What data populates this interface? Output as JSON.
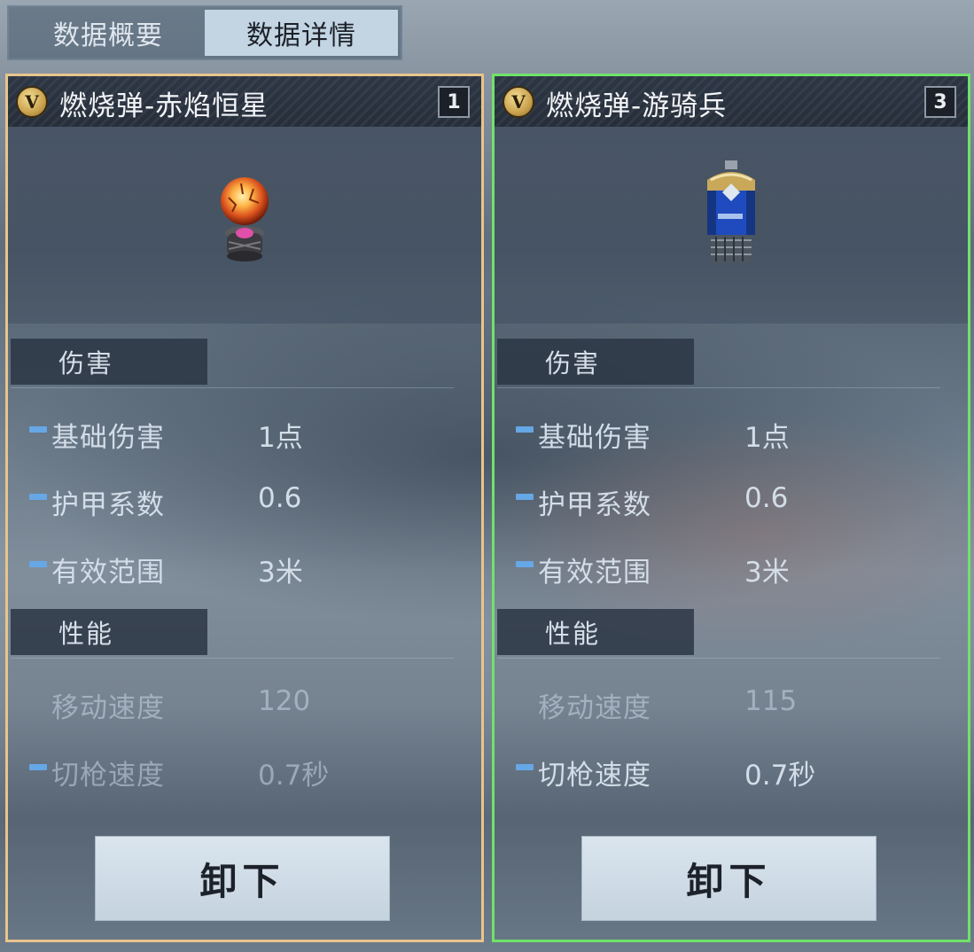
{
  "tabs": [
    {
      "label": "数据概要",
      "active": false
    },
    {
      "label": "数据详情",
      "active": true
    }
  ],
  "cards": [
    {
      "badge": "V",
      "title": "燃烧弹-赤焰恒星",
      "count": "1",
      "item_icon": "fire-orb-grenade-icon",
      "frame_color": "#e8c48d",
      "sections": [
        {
          "label": "伤害",
          "stats": [
            {
              "indicator": "neutral",
              "label": "基础伤害",
              "value": "1点"
            },
            {
              "indicator": "neutral",
              "label": "护甲系数",
              "value": "0.6"
            },
            {
              "indicator": "neutral",
              "label": "有效范围",
              "value": "3米"
            }
          ]
        },
        {
          "label": "性能",
          "stats": [
            {
              "indicator": "up",
              "label": "移动速度",
              "value": "120"
            },
            {
              "indicator": "neutral",
              "label": "切枪速度",
              "value": "0.7秒"
            }
          ]
        }
      ],
      "button_label": "卸下"
    },
    {
      "badge": "V",
      "title": "燃烧弹-游骑兵",
      "count": "3",
      "item_icon": "blue-canister-grenade-icon",
      "frame_color": "#6fe36a",
      "sections": [
        {
          "label": "伤害",
          "stats": [
            {
              "indicator": "neutral",
              "label": "基础伤害",
              "value": "1点"
            },
            {
              "indicator": "neutral",
              "label": "护甲系数",
              "value": "0.6"
            },
            {
              "indicator": "neutral",
              "label": "有效范围",
              "value": "3米"
            }
          ]
        },
        {
          "label": "性能",
          "stats": [
            {
              "indicator": "down",
              "label": "移动速度",
              "value": "115"
            },
            {
              "indicator": "neutral",
              "label": "切枪速度",
              "value": "0.7秒"
            }
          ]
        }
      ],
      "button_label": "卸下"
    }
  ],
  "colors": {
    "indicator_neutral": "#66a7e6",
    "indicator_up": "#4fd35a",
    "indicator_down": "#e23b3b"
  }
}
